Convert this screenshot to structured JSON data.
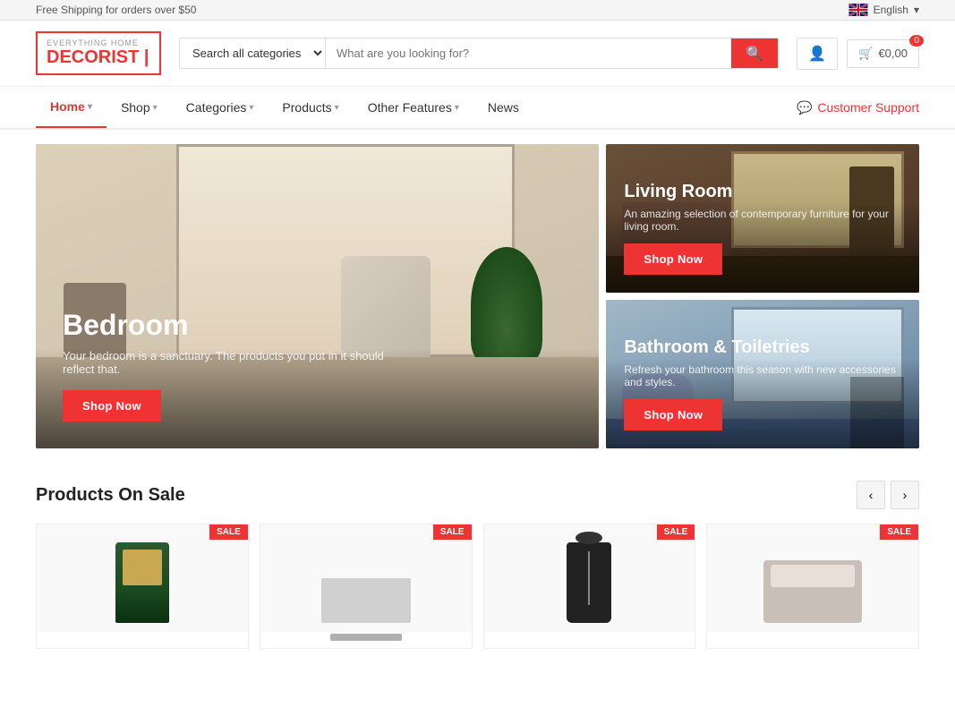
{
  "topbar": {
    "shipping_text": "Free Shipping for orders over $50",
    "language": "English"
  },
  "header": {
    "logo_sub": "EVERYTHING HOME",
    "logo_main": "DECORIST",
    "search_placeholder": "What are you looking for?",
    "search_categories_label": "Search all categories",
    "cart_count": "0",
    "cart_price": "€0,00"
  },
  "nav": {
    "items": [
      {
        "label": "Home",
        "active": true,
        "has_dropdown": true
      },
      {
        "label": "Shop",
        "active": false,
        "has_dropdown": true
      },
      {
        "label": "Categories",
        "active": false,
        "has_dropdown": true
      },
      {
        "label": "Products",
        "active": false,
        "has_dropdown": true
      },
      {
        "label": "Other Features",
        "active": false,
        "has_dropdown": true
      },
      {
        "label": "News",
        "active": false,
        "has_dropdown": false
      }
    ],
    "customer_support": "Customer Support"
  },
  "hero": {
    "main": {
      "title": "Bedroom",
      "description": "Your bedroom is a sanctuary. The products you put in it should reflect that.",
      "cta": "Shop Now"
    },
    "cards": [
      {
        "title": "Living Room",
        "description": "An amazing selection of contemporary furniture for your living room.",
        "cta": "Shop Now"
      },
      {
        "title": "Bathroom & Toiletries",
        "description": "Refresh your bathroom this season with new accessories and styles.",
        "cta": "Shop Now"
      }
    ]
  },
  "products_section": {
    "title": "Products On Sale",
    "prev_label": "‹",
    "next_label": "›",
    "products": [
      {
        "badge": "SALE"
      },
      {
        "badge": "SALE"
      },
      {
        "badge": "SALE"
      },
      {
        "badge": "SALE"
      }
    ]
  }
}
